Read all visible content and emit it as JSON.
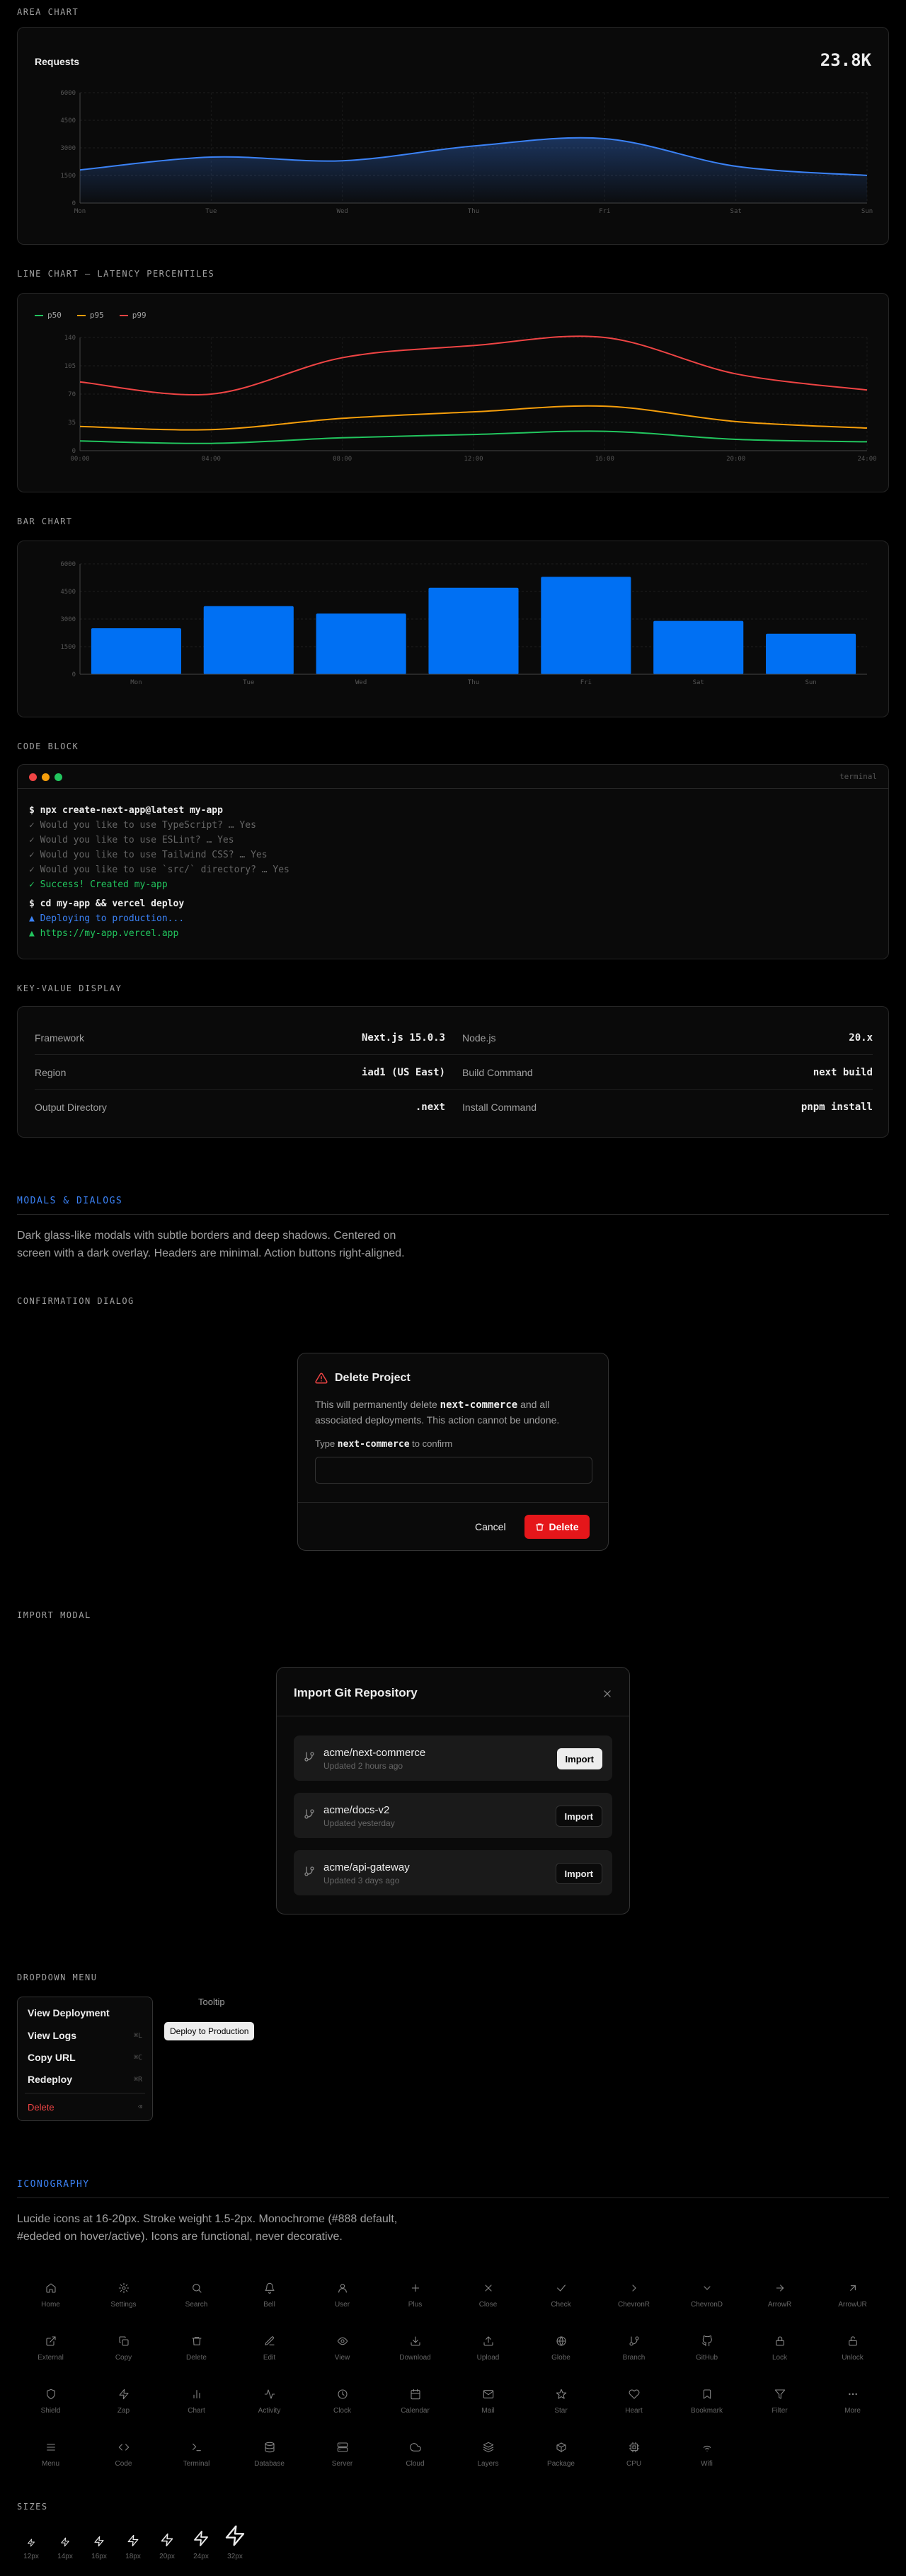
{
  "sections": {
    "area": "AREA CHART",
    "line": "LINE CHART — LATENCY PERCENTILES",
    "bar": "BAR CHART",
    "code": "CODE BLOCK",
    "kv": "KEY-VALUE DISPLAY",
    "modals": "MODALS & DIALOGS",
    "confirm": "CONFIRMATION DIALOG",
    "import": "IMPORT MODAL",
    "dropdown": "DROPDOWN MENU",
    "icons": "ICONOGRAPHY",
    "sizes": "SIZES"
  },
  "chart_data": [
    {
      "type": "area",
      "title": "Requests",
      "stat": "23.8K",
      "categories": [
        "Mon",
        "Tue",
        "Wed",
        "Thu",
        "Fri",
        "Sat",
        "Sun"
      ],
      "values": [
        1800,
        2500,
        2300,
        3100,
        3500,
        2000,
        1500
      ],
      "yticks": [
        "0",
        "1500",
        "3000",
        "4500",
        "6000"
      ],
      "ylim": [
        0,
        6000
      ],
      "color": "#3b82f6"
    },
    {
      "type": "line",
      "x": [
        "00:00",
        "04:00",
        "08:00",
        "12:00",
        "16:00",
        "20:00",
        "24:00"
      ],
      "yticks": [
        "0",
        "35",
        "70",
        "105",
        "140"
      ],
      "ylim": [
        0,
        140
      ],
      "series": [
        {
          "name": "p50",
          "color": "#22c55e",
          "values": [
            12,
            9,
            16,
            20,
            24,
            14,
            11
          ]
        },
        {
          "name": "p95",
          "color": "#f59e0b",
          "values": [
            30,
            26,
            40,
            48,
            55,
            36,
            28
          ]
        },
        {
          "name": "p99",
          "color": "#ef4444",
          "values": [
            85,
            70,
            115,
            130,
            140,
            95,
            75
          ]
        }
      ]
    },
    {
      "type": "bar",
      "categories": [
        "Mon",
        "Tue",
        "Wed",
        "Thu",
        "Fri",
        "Sat",
        "Sun"
      ],
      "values": [
        2500,
        3700,
        3300,
        4700,
        5300,
        2900,
        2200
      ],
      "yticks": [
        "0",
        "1500",
        "3000",
        "4500",
        "6000"
      ],
      "ylim": [
        0,
        6000
      ],
      "color": "#0070f3"
    }
  ],
  "terminal": {
    "title": "terminal",
    "lines": [
      {
        "text": "$ npx create-next-app@latest my-app",
        "color": "#ededed"
      },
      {
        "text": "✓ Would you like to use TypeScript? … Yes",
        "color": "#666"
      },
      {
        "text": "✓ Would you like to use ESLint? … Yes",
        "color": "#666"
      },
      {
        "text": "✓ Would you like to use Tailwind CSS? … Yes",
        "color": "#666"
      },
      {
        "text": "✓ Would you like to use `src/` directory? … Yes",
        "color": "#666"
      },
      {
        "text": "✓ Success! Created my-app",
        "color": "#22c55e"
      },
      {
        "text": "",
        "color": "#666"
      },
      {
        "text": "$ cd my-app && vercel deploy",
        "color": "#ededed"
      },
      {
        "text": "▲ Deploying to production...",
        "color": "#3b82f6"
      },
      {
        "text": "▲ https://my-app.vercel.app",
        "color": "#22c55e"
      }
    ]
  },
  "kv": [
    {
      "k": "Framework",
      "v": "Next.js 15.0.3"
    },
    {
      "k": "Node.js",
      "v": "20.x"
    },
    {
      "k": "Region",
      "v": "iad1 (US East)"
    },
    {
      "k": "Build Command",
      "v": "next build"
    },
    {
      "k": "Output Directory",
      "v": ".next"
    },
    {
      "k": "Install Command",
      "v": "pnpm install"
    }
  ],
  "modals_desc": "Dark glass-like modals with subtle borders and deep shadows. Centered on screen with a dark overlay. Headers are minimal. Action buttons right-aligned.",
  "confirm": {
    "title": "Delete Project",
    "body_pre": "This will permanently delete ",
    "body_name": "next-commerce",
    "body_post": " and all associated deployments. This action cannot be undone.",
    "type_pre": "Type ",
    "type_name": "next-commerce",
    "type_post": " to confirm",
    "input_value": "",
    "cancel": "Cancel",
    "delete": "Delete"
  },
  "import_modal": {
    "title": "Import Git Repository",
    "repos": [
      {
        "name": "acme/next-commerce",
        "updated": "Updated 2 hours ago",
        "primary": true
      },
      {
        "name": "acme/docs-v2",
        "updated": "Updated yesterday",
        "primary": false
      },
      {
        "name": "acme/api-gateway",
        "updated": "Updated 3 days ago",
        "primary": false
      }
    ],
    "import_label": "Import"
  },
  "dropdown": {
    "items": [
      {
        "label": "View Deployment",
        "shortcut": ""
      },
      {
        "label": "View Logs",
        "shortcut": "⌘L"
      },
      {
        "label": "Copy URL",
        "shortcut": "⌘C"
      },
      {
        "label": "Redeploy",
        "shortcut": "⌘R"
      }
    ],
    "danger": {
      "label": "Delete",
      "shortcut": "⌫"
    },
    "tooltip_label": "Tooltip",
    "tooltip_text": "Deploy to Production"
  },
  "icons_desc": "Lucide icons at 16-20px. Stroke weight 1.5-2px. Monochrome (#888 default, #ededed on hover/active). Icons are functional, never decorative.",
  "icons": [
    "Home",
    "Settings",
    "Search",
    "Bell",
    "User",
    "Plus",
    "Close",
    "Check",
    "ChevronR",
    "ChevronD",
    "ArrowR",
    "ArrowUR",
    "External",
    "Copy",
    "Delete",
    "Edit",
    "View",
    "Download",
    "Upload",
    "Globe",
    "Branch",
    "GitHub",
    "Lock",
    "Unlock",
    "Shield",
    "Zap",
    "Chart",
    "Activity",
    "Clock",
    "Calendar",
    "Mail",
    "Star",
    "Heart",
    "Bookmark",
    "Filter",
    "More",
    "Menu",
    "Code",
    "Terminal",
    "Database",
    "Server",
    "Cloud",
    "Layers",
    "Package",
    "CPU",
    "Wifi"
  ],
  "sizes": [
    "12px",
    "14px",
    "16px",
    "18px",
    "20px",
    "24px",
    "32px"
  ]
}
